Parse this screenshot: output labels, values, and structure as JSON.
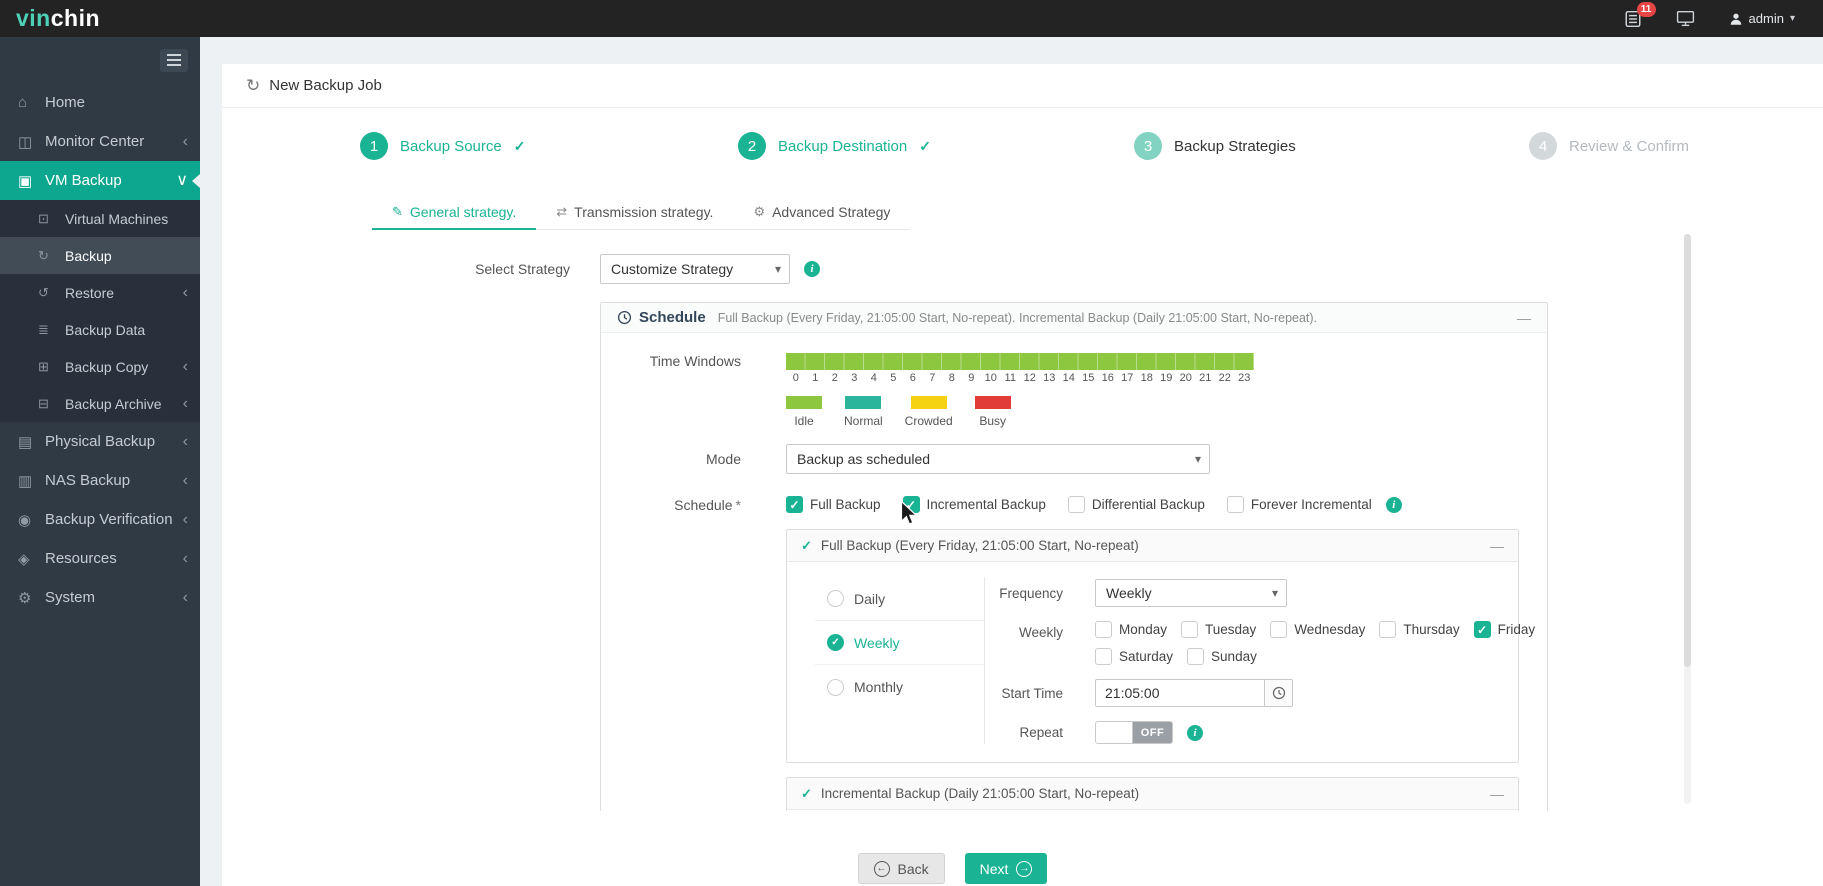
{
  "colors": {
    "accent": "#1ab394",
    "sidebar_active": "#0ca78e",
    "idle_green": "#8dc63f",
    "normal_teal": "#2bb59a",
    "crowded_yellow": "#f5d313",
    "busy_red": "#e23c39",
    "badge_red": "#e64545"
  },
  "topbar": {
    "logo": {
      "part1": "vin",
      "part2": "chin"
    },
    "notification_badge": "11",
    "user_label": "admin"
  },
  "sidebar": {
    "items": [
      {
        "label": "Home",
        "icon": "home-icon",
        "chevron": "",
        "sub": false,
        "active": false,
        "selected": false
      },
      {
        "label": "Monitor Center",
        "icon": "monitor-center-icon",
        "chevron": "left",
        "sub": false,
        "active": false,
        "selected": false
      },
      {
        "label": "VM Backup",
        "icon": "vm-backup-icon",
        "chevron": "down",
        "sub": false,
        "active": true,
        "selected": false
      },
      {
        "label": "Virtual Machines",
        "icon": "virtual-machines-icon",
        "chevron": "",
        "sub": true,
        "active": false,
        "selected": false
      },
      {
        "label": "Backup",
        "icon": "backup-icon",
        "chevron": "",
        "sub": true,
        "active": false,
        "selected": true
      },
      {
        "label": "Restore",
        "icon": "restore-icon",
        "chevron": "left",
        "sub": true,
        "active": false,
        "selected": false
      },
      {
        "label": "Backup Data",
        "icon": "backup-data-icon",
        "chevron": "",
        "sub": true,
        "active": false,
        "selected": false
      },
      {
        "label": "Backup Copy",
        "icon": "backup-copy-icon",
        "chevron": "left",
        "sub": true,
        "active": false,
        "selected": false
      },
      {
        "label": "Backup Archive",
        "icon": "backup-archive-icon",
        "chevron": "left",
        "sub": true,
        "active": false,
        "selected": false
      },
      {
        "label": "Physical Backup",
        "icon": "physical-backup-icon",
        "chevron": "left",
        "sub": false,
        "active": false,
        "selected": false
      },
      {
        "label": "NAS Backup",
        "icon": "nas-backup-icon",
        "chevron": "left",
        "sub": false,
        "active": false,
        "selected": false
      },
      {
        "label": "Backup Verification",
        "icon": "backup-verification-icon",
        "chevron": "left",
        "sub": false,
        "active": false,
        "selected": false
      },
      {
        "label": "Resources",
        "icon": "resources-icon",
        "chevron": "left",
        "sub": false,
        "active": false,
        "selected": false
      },
      {
        "label": "System",
        "icon": "system-icon",
        "chevron": "left",
        "sub": false,
        "active": false,
        "selected": false
      }
    ]
  },
  "page": {
    "title": "New Backup Job"
  },
  "steps": [
    {
      "num": "1",
      "label": "Backup Source",
      "state": "done"
    },
    {
      "num": "2",
      "label": "Backup Destination",
      "state": "done"
    },
    {
      "num": "3",
      "label": "Backup Strategies",
      "state": "active"
    },
    {
      "num": "4",
      "label": "Review & Confirm",
      "state": "disabled"
    }
  ],
  "tabs": [
    {
      "label": "General strategy.",
      "icon": "edit-icon",
      "active": true
    },
    {
      "label": "Transmission strategy.",
      "icon": "transfer-icon",
      "active": false
    },
    {
      "label": "Advanced Strategy",
      "icon": "advanced-icon",
      "active": false
    }
  ],
  "form": {
    "select_strategy_label": "Select Strategy",
    "select_strategy_value": "Customize Strategy"
  },
  "schedule_panel": {
    "title": "Schedule",
    "summary": "Full Backup (Every Friday, 21:05:00 Start, No-repeat). Incremental Backup (Daily 21:05:00 Start, No-repeat).",
    "collapse_glyph": "—",
    "time_windows": {
      "label": "Time Windows",
      "hours": [
        "0",
        "1",
        "2",
        "3",
        "4",
        "5",
        "6",
        "7",
        "8",
        "9",
        "10",
        "11",
        "12",
        "13",
        "14",
        "15",
        "16",
        "17",
        "18",
        "19",
        "20",
        "21",
        "22",
        "23"
      ],
      "legend": [
        {
          "label": "Idle",
          "color": "#8dc63f"
        },
        {
          "label": "Normal",
          "color": "#2bb59a"
        },
        {
          "label": "Crowded",
          "color": "#f5d313"
        },
        {
          "label": "Busy",
          "color": "#e23c39"
        }
      ]
    },
    "mode_label": "Mode",
    "mode_value": "Backup as scheduled",
    "schedule_label": "Schedule",
    "required_mark": "*",
    "schedule_types": [
      {
        "label": "Full Backup",
        "checked": true
      },
      {
        "label": "Incremental Backup",
        "checked": true
      },
      {
        "label": "Differential Backup",
        "checked": false
      },
      {
        "label": "Forever Incremental",
        "checked": false
      }
    ]
  },
  "full_backup_panel": {
    "header": "Full Backup (Every Friday, 21:05:00 Start, No-repeat)",
    "collapse_glyph": "—",
    "frequency_options": [
      {
        "label": "Daily",
        "selected": false
      },
      {
        "label": "Weekly",
        "selected": true
      },
      {
        "label": "Monthly",
        "selected": false
      }
    ],
    "frequency_label": "Frequency",
    "frequency_value": "Weekly",
    "weekly_label": "Weekly",
    "days": [
      {
        "label": "Monday",
        "checked": false
      },
      {
        "label": "Tuesday",
        "checked": false
      },
      {
        "label": "Wednesday",
        "checked": false
      },
      {
        "label": "Thursday",
        "checked": false
      },
      {
        "label": "Friday",
        "checked": true
      },
      {
        "label": "Saturday",
        "checked": false
      },
      {
        "label": "Sunday",
        "checked": false
      }
    ],
    "start_time_label": "Start Time",
    "start_time_value": "21:05:00",
    "repeat_label": "Repeat",
    "repeat_state": "OFF"
  },
  "incremental_panel": {
    "header": "Incremental Backup (Daily 21:05:00 Start, No-repeat)",
    "collapse_glyph": "—"
  },
  "footer": {
    "back_label": "Back",
    "next_label": "Next"
  }
}
